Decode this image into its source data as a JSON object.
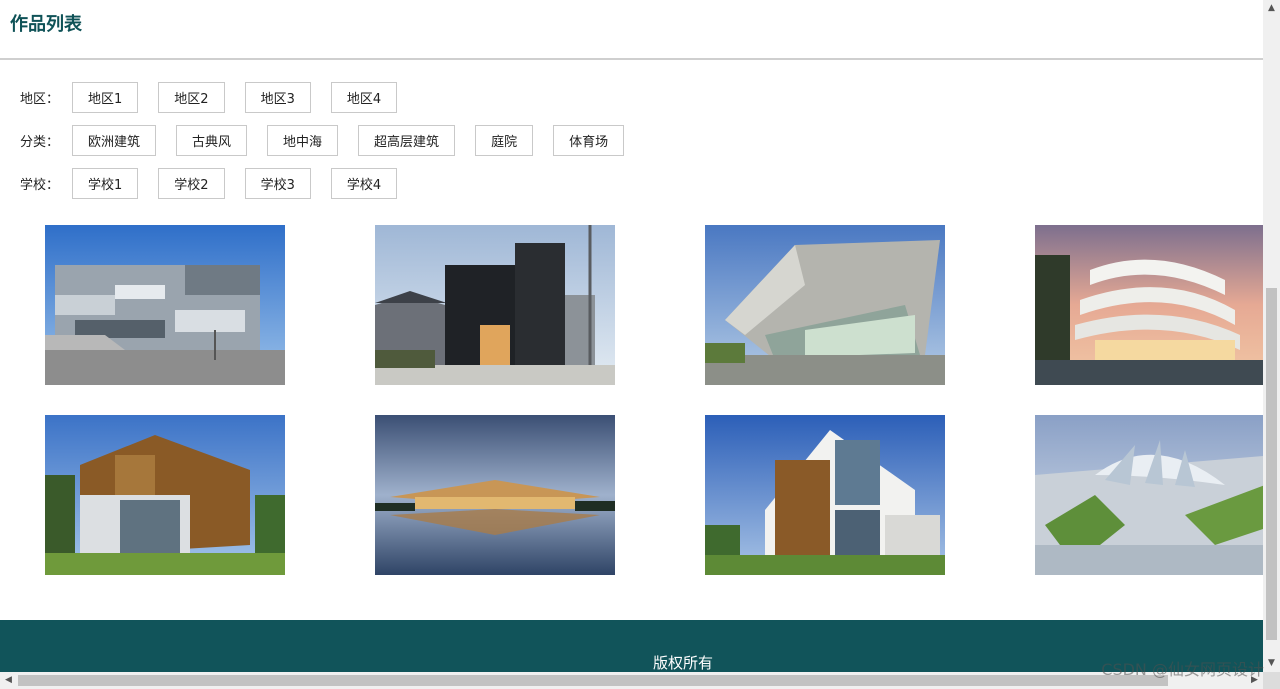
{
  "page": {
    "title": "作品列表"
  },
  "filters": [
    {
      "label": "地区：",
      "options": [
        "地区1",
        "地区2",
        "地区3",
        "地区4"
      ]
    },
    {
      "label": "分类：",
      "options": [
        "欧洲建筑",
        "古典风",
        "地中海",
        "超高层建筑",
        "庭院",
        "体育场"
      ]
    },
    {
      "label": "学校：",
      "options": [
        "学校1",
        "学校2",
        "学校3",
        "学校4"
      ]
    }
  ],
  "gallery": {
    "items": [
      {
        "name": "work-thumbnail-1",
        "scene": "glass-cube-building"
      },
      {
        "name": "work-thumbnail-2",
        "scene": "black-house"
      },
      {
        "name": "work-thumbnail-3",
        "scene": "angular-concrete"
      },
      {
        "name": "work-thumbnail-4",
        "scene": "curved-white-building"
      },
      {
        "name": "work-thumbnail-5",
        "scene": "wood-panel-house"
      },
      {
        "name": "work-thumbnail-6",
        "scene": "pavilion-reflection"
      },
      {
        "name": "work-thumbnail-7",
        "scene": "wood-glass-house"
      },
      {
        "name": "work-thumbnail-8",
        "scene": "shell-pavilion"
      }
    ]
  },
  "footer": {
    "copyright": "版权所有"
  },
  "watermark": "CSDN @仙女网页设计",
  "colors": {
    "accent": "#0f5257",
    "footer_bg": "#11545a"
  }
}
